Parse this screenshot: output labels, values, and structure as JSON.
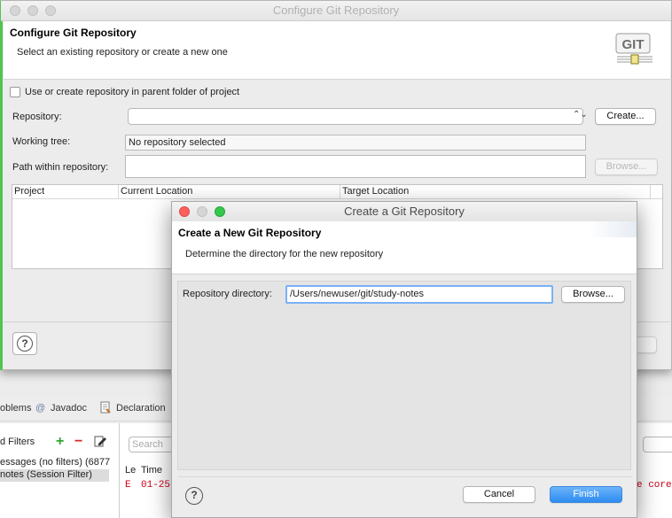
{
  "ide": {
    "tabs": [
      {
        "label": "oblems"
      },
      {
        "icon": "@",
        "label": "Javadoc"
      },
      {
        "label": "Declaration"
      }
    ],
    "filters_title": "d Filters",
    "filter_rows": [
      "essages (no filters) (6877",
      "notes (Session Filter)"
    ],
    "search_placeholder": "Search",
    "columns": [
      "Le",
      "Time"
    ],
    "log_row": {
      "level": "E",
      "time": "01-25",
      "tail": "e core"
    }
  },
  "configure": {
    "window_title": "Configure Git Repository",
    "header_title": "Configure Git Repository",
    "header_subtitle": "Select an existing repository or create a new one",
    "git_logo_text": "GIT",
    "parent_folder_checkbox": "Use or create repository in parent folder of project",
    "repository_label": "Repository:",
    "repository_value": "",
    "create_button": "Create...",
    "working_tree_label": "Working tree:",
    "working_tree_value": "No repository selected",
    "path_label": "Path within repository:",
    "path_value": "",
    "browse_button": "Browse...",
    "table_columns": [
      "Project",
      "Current Location",
      "Target Location"
    ],
    "help_label": "?"
  },
  "create_dialog": {
    "window_title": "Create a Git Repository",
    "header_title": "Create a New Git Repository",
    "header_subtitle": "Determine the directory for the new repository",
    "repo_dir_label": "Repository directory:",
    "repo_dir_value": "/Users/newuser/git/study-notes",
    "browse_button": "Browse...",
    "help_label": "?",
    "cancel_button": "Cancel",
    "finish_button": "Finish"
  },
  "colors": {
    "close": "#fc605c",
    "minimize": "#fdbc40",
    "zoom": "#34c84a",
    "primary_button": "#2d8cf0",
    "focus_ring": "#7bb1f5",
    "log_error": "#d0021b",
    "window_edge": "#51c451"
  }
}
